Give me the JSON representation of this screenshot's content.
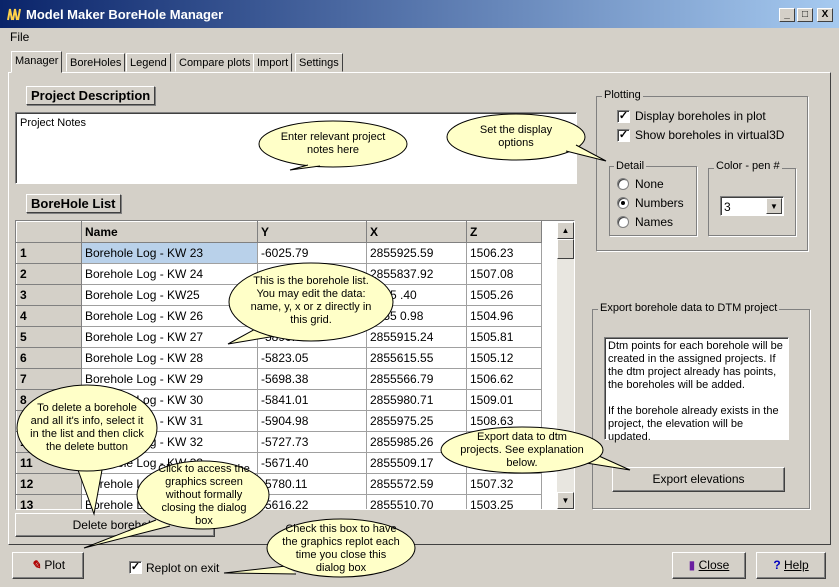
{
  "window": {
    "title": "Model Maker BoreHole Manager",
    "minimize": "_",
    "maximize": "□",
    "close": "X"
  },
  "menu": {
    "file": "File"
  },
  "tabs": [
    "Manager",
    "BoreHoles",
    "Legend",
    "Compare plots",
    "Import",
    "Settings"
  ],
  "project": {
    "header": "Project Description",
    "notes": "Project Notes"
  },
  "borehole_list": {
    "header": "BoreHole List",
    "columns": [
      "",
      "Name",
      "Y",
      "X",
      "Z"
    ],
    "rows": [
      [
        "1",
        "Borehole Log - KW 23",
        "-6025.79",
        "2855925.59",
        "1506.23"
      ],
      [
        "2",
        "Borehole Log - KW 24",
        "",
        "2855837.92",
        "1507.08"
      ],
      [
        "3",
        "Borehole Log - KW25",
        "",
        "2855  .40",
        "1505.26"
      ],
      [
        "4",
        "Borehole Log - KW 26",
        "",
        "2855  0.98",
        "1504.96"
      ],
      [
        "5",
        "Borehole Log - KW 27",
        "-5890.03",
        "2855915.24",
        "1505.81"
      ],
      [
        "6",
        "Borehole Log - KW 28",
        "-5823.05",
        "2855615.55",
        "1505.12"
      ],
      [
        "7",
        "Borehole Log - KW 29",
        "-5698.38",
        "2855566.79",
        "1506.62"
      ],
      [
        "8",
        "Borehole Log - KW 30",
        "-5841.01",
        "2855980.71",
        "1509.01"
      ],
      [
        "9",
        "Borehole Log - KW 31",
        "-5904.98",
        "2855975.25",
        "1508.63"
      ],
      [
        "10",
        "Borehole Log - KW 32",
        "-5727.73",
        "2855985.26",
        "1508.12"
      ],
      [
        "11",
        "Borehole Log - KW 33",
        "-5671.40",
        "2855509.17",
        "1507.40"
      ],
      [
        "12",
        "Borehole Log - KW 34",
        "-5780.11",
        "2855572.59",
        "1507.32"
      ],
      [
        "13",
        "Borehole Log - KW 35",
        "-5616.22",
        "2855510.70",
        "1503.25"
      ]
    ],
    "delete_button": "Delete borehole"
  },
  "plotting": {
    "title": "Plotting",
    "display_in_plot": "Display boreholes in plot",
    "show_virtual3d": "Show boreholes in virtual3D",
    "detail": {
      "title": "Detail",
      "options": [
        "None",
        "Numbers",
        "Names"
      ],
      "selected": "Numbers"
    },
    "color": {
      "title": "Color - pen #",
      "value": "3"
    }
  },
  "export": {
    "title": "Export borehole data to DTM project",
    "text1": "Dtm points for each borehole will be created in the assigned projects. If the dtm project already has points, the boreholes will be added.",
    "text2": "If the borehole already exists in the project, the elevation will be updated.",
    "button": "Export elevations"
  },
  "bottom": {
    "plot": "Plot",
    "replot": "Replot on exit",
    "close": "Close",
    "help": "Help"
  },
  "callouts": {
    "notes": "Enter relevant project notes here",
    "display": "Set the display options",
    "list": "This is the borehole list. You may edit the data: name, y, x or z directly in this grid.",
    "delete": "To delete a borehole and all it's info, select it in the list and then click the delete button",
    "export": "Export data to dtm projects. See explanation below.",
    "plot": "Click to access the graphics screen without formally closing the dialog box",
    "replot": "Check this box to have the graphics replot each time you close this dialog box"
  },
  "colors": {
    "titlebar": "#0a246a",
    "face": "#d4d0c8",
    "selection": "#b9d1ea",
    "callout": "#ffffc8"
  }
}
